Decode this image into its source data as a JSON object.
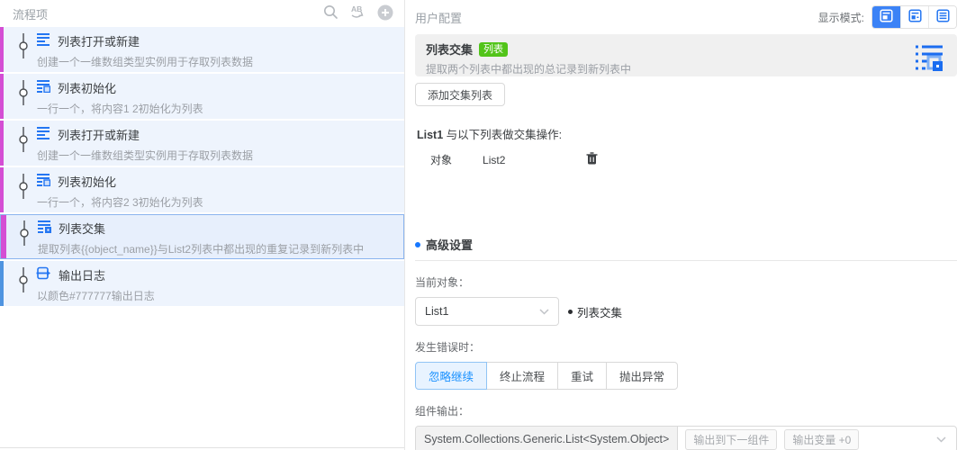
{
  "left_panel": {
    "title": "流程项",
    "items": [
      {
        "title": "列表打开或新建",
        "subtitle": "创建一个一维数组类型实例用于存取列表数据",
        "icon": "list-icon",
        "accent": "#d44ed4",
        "selected": false
      },
      {
        "title": "列表初始化",
        "subtitle": "一行一个，将内容1 2初始化为列表",
        "icon": "list-init-icon",
        "accent": "#d44ed4",
        "selected": false
      },
      {
        "title": "列表打开或新建",
        "subtitle": "创建一个一维数组类型实例用于存取列表数据",
        "icon": "list-icon",
        "accent": "#d44ed4",
        "selected": false
      },
      {
        "title": "列表初始化",
        "subtitle": "一行一个，将内容2 3初始化为列表",
        "icon": "list-init-icon",
        "accent": "#d44ed4",
        "selected": false
      },
      {
        "title": "列表交集",
        "subtitle": "提取列表{{object_name}}与List2列表中都出现的重复记录到新列表中",
        "icon": "list-intersect-icon",
        "accent": "#d44ed4",
        "selected": true
      },
      {
        "title": "输出日志",
        "subtitle": "以颜色#777777输出日志",
        "icon": "log-output-icon",
        "accent": "#4f94e0",
        "selected": false
      }
    ]
  },
  "right_panel": {
    "title": "用户配置",
    "display_mode_label": "显示模式:",
    "card": {
      "title": "列表交集",
      "badge": "列表",
      "subtitle": "提取两个列表中都出现的总记录到新列表中"
    },
    "add_button": "添加交集列表",
    "target_line": {
      "bold": "List1",
      "rest": "与以下列表做交集操作:"
    },
    "object_row": {
      "label": "对象",
      "value": "List2"
    },
    "advanced": {
      "section_title": "高级设置",
      "current_object_label": "当前对象：",
      "current_object_value": "List1",
      "current_object_hint": "列表交集"
    },
    "error_label": "发生错误时：",
    "error_options": [
      "忽略继续",
      "终止流程",
      "重试",
      "抛出异常"
    ],
    "error_selected_index": 0,
    "output_label": "组件输出：",
    "output_type": "System.Collections.Generic.List<System.Object>",
    "output_tags": [
      "输出到下一组件",
      "输出变量 +0"
    ]
  },
  "colors": {
    "accent_blue_icon": "#2476f2",
    "accent_magenta": "#d44ed4",
    "accent_item_blue": "#4f94e0",
    "item_background": "#eef4fd",
    "selected_border": "#8ab4ef",
    "badge_green": "#52c41a",
    "mode_selected_blue": "#3b82f6",
    "error_selected_blue": "#1890ff"
  }
}
